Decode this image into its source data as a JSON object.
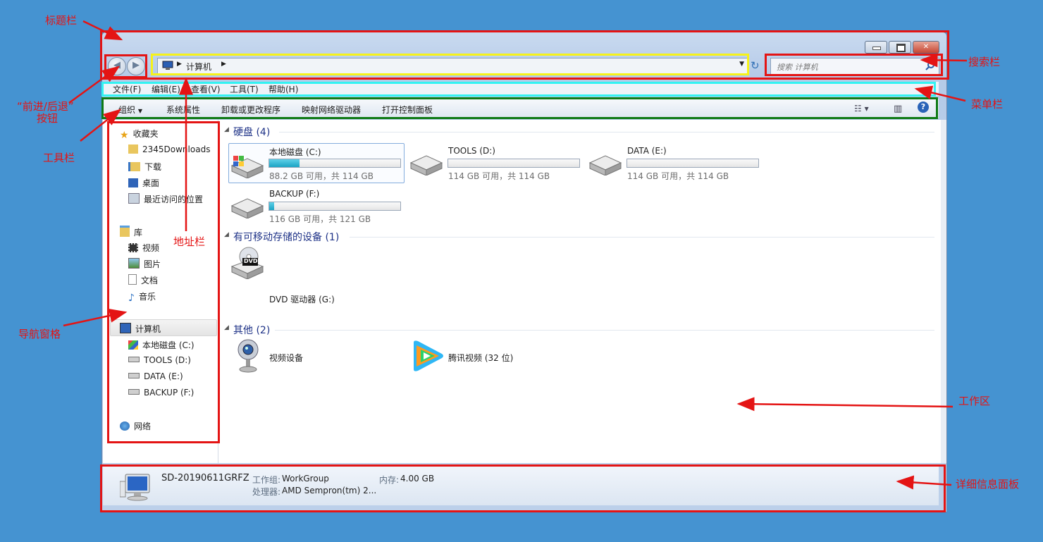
{
  "annotations": {
    "title_bar": "标题栏",
    "search_bar": "搜索栏",
    "nav_buttons": "“前进/后退”",
    "nav_buttons_2": "按钮",
    "menu_bar": "菜单栏",
    "toolbar": "工具栏",
    "address_bar": "地址栏",
    "nav_pane": "导航窗格",
    "work_area": "工作区",
    "details_panel": "详细信息面板"
  },
  "address": {
    "location": "计算机"
  },
  "search": {
    "placeholder": "搜索 计算机"
  },
  "menu": [
    "文件(F)",
    "编辑(E)",
    "查看(V)",
    "工具(T)",
    "帮助(H)"
  ],
  "toolbar": {
    "organize": "组织",
    "items": [
      "系统属性",
      "卸载或更改程序",
      "映射网络驱动器",
      "打开控制面板"
    ]
  },
  "nav": {
    "favorites": "收藏夹",
    "fav_items": [
      "2345Downloads",
      "下载",
      "桌面",
      "最近访问的位置"
    ],
    "libraries": "库",
    "lib_items": [
      "视频",
      "图片",
      "文档",
      "音乐"
    ],
    "computer": "计算机",
    "drives": [
      "本地磁盘 (C:)",
      "TOOLS (D:)",
      "DATA (E:)",
      "BACKUP (F:)"
    ],
    "network": "网络"
  },
  "groups": {
    "hdd": "硬盘 (4)",
    "removable": "有可移动存储的设备 (1)",
    "other": "其他 (2)"
  },
  "drives": [
    {
      "name": "本地磁盘 (C:)",
      "space": "88.2 GB 可用，共 114 GB",
      "used_fraction": 0.23
    },
    {
      "name": "TOOLS (D:)",
      "space": "114 GB 可用，共 114 GB",
      "used_fraction": 0.0
    },
    {
      "name": "DATA (E:)",
      "space": "114 GB 可用，共 114 GB",
      "used_fraction": 0.0
    },
    {
      "name": "BACKUP (F:)",
      "space": "116 GB 可用，共 121 GB",
      "used_fraction": 0.04
    }
  ],
  "dvd": {
    "name": "DVD 驱动器 (G:)",
    "badge": "DVD"
  },
  "others": [
    "视频设备",
    "腾讯视频 (32 位)"
  ],
  "details": {
    "pc_name": "SD-20190611GRFZ",
    "workgroup_label": "工作组:",
    "workgroup": "WorkGroup",
    "memory_label": "内存:",
    "memory": "4.00 GB",
    "cpu_label": "处理器:",
    "cpu": "AMD Sempron(tm) 2..."
  },
  "colors": {
    "background": "#4593d1",
    "annotation": "#e41414",
    "progress": "#1aa4c4"
  }
}
